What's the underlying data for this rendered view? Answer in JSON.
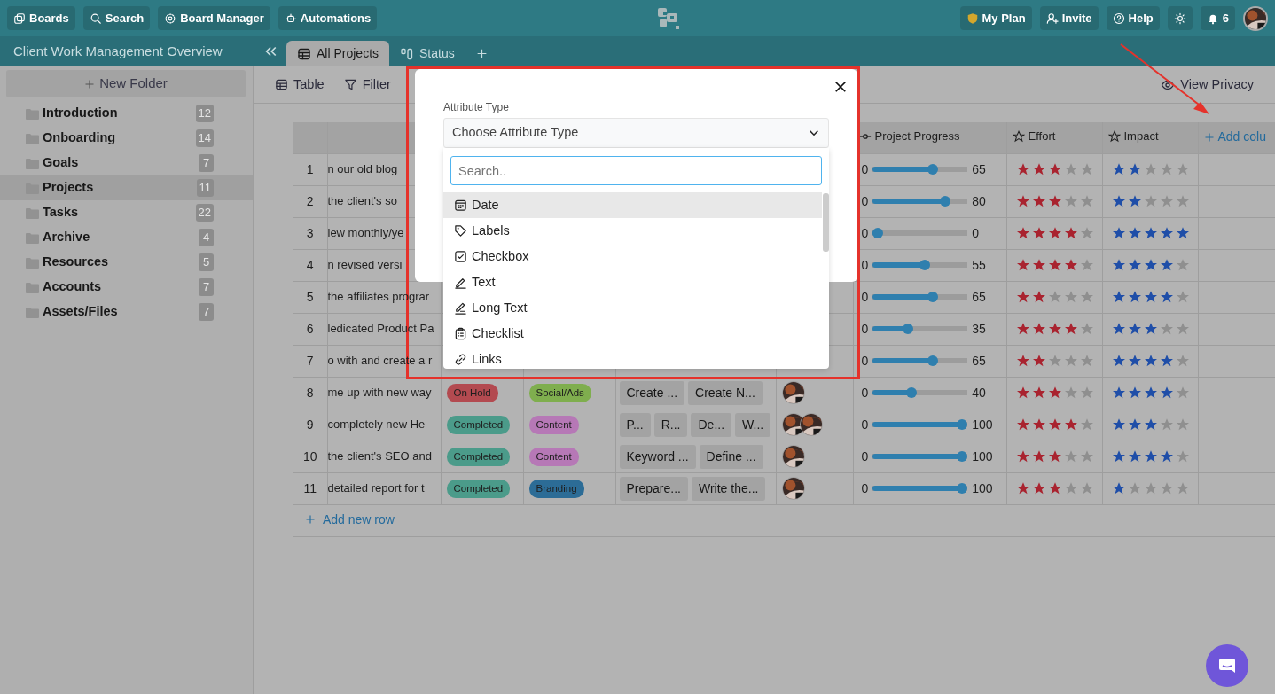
{
  "topbar": {
    "left_buttons": [
      {
        "kind": "boards",
        "label": "Boards"
      },
      {
        "kind": "search",
        "label": "Search"
      },
      {
        "kind": "manager",
        "label": "Board Manager"
      },
      {
        "kind": "automations",
        "label": "Automations"
      }
    ],
    "right_buttons": [
      {
        "kind": "plan",
        "label": "My Plan"
      },
      {
        "kind": "invite",
        "label": "Invite"
      },
      {
        "kind": "help",
        "label": "Help"
      },
      {
        "kind": "theme"
      },
      {
        "kind": "notifications",
        "label": "6"
      }
    ]
  },
  "board_title": "Client Work Management Overview",
  "tabs": [
    {
      "kind": "table",
      "label": "All Projects",
      "selected": true
    },
    {
      "kind": "kanban",
      "label": "Status",
      "selected": false
    }
  ],
  "sidebar": {
    "new_folder": "New Folder",
    "items": [
      {
        "label": "Introduction",
        "count": "12",
        "selected": false
      },
      {
        "label": "Onboarding",
        "count": "14",
        "selected": false
      },
      {
        "label": "Goals",
        "count": "7",
        "selected": false
      },
      {
        "label": "Projects",
        "count": "11",
        "selected": true
      },
      {
        "label": "Tasks",
        "count": "22",
        "selected": false
      },
      {
        "label": "Archive",
        "count": "4",
        "selected": false
      },
      {
        "label": "Resources",
        "count": "5",
        "selected": false
      },
      {
        "label": "Accounts",
        "count": "7",
        "selected": false
      },
      {
        "label": "Assets/Files",
        "count": "7",
        "selected": false
      }
    ]
  },
  "toolbar": {
    "left": [
      {
        "kind": "table",
        "label": "Table"
      },
      {
        "kind": "filter",
        "label": "Filter"
      }
    ],
    "view_privacy": "View Privacy"
  },
  "table": {
    "columns": [
      {
        "kind": "progress",
        "label": "Project Progress"
      },
      {
        "kind": "stars",
        "label": "Effort"
      },
      {
        "kind": "stars",
        "label": "Impact"
      }
    ],
    "add_column": "Add colu",
    "rows": [
      {
        "number": "1",
        "title": "n our old blog",
        "progress": {
          "min": "0",
          "level": 0.65,
          "value": "65"
        },
        "effort": {
          "stars": 3
        },
        "impact": {
          "stars": 2
        }
      },
      {
        "number": "2",
        "title": "the client's so",
        "progress": {
          "min": "0",
          "level": 0.8,
          "value": "80"
        },
        "effort": {
          "stars": 3
        },
        "impact": {
          "stars": 2
        }
      },
      {
        "number": "3",
        "title": "iew monthly/ye",
        "progress": {
          "min": "0",
          "level": 0,
          "value": "0"
        },
        "effort": {
          "stars": 4
        },
        "impact": {
          "stars": 5
        }
      },
      {
        "number": "4",
        "title": "n revised versi",
        "progress": {
          "min": "0",
          "level": 0.55,
          "value": "55"
        },
        "effort": {
          "stars": 4
        },
        "impact": {
          "stars": 4
        }
      },
      {
        "number": "5",
        "title": "the affiliates prograr",
        "progress": {
          "min": "0",
          "level": 0.65,
          "value": "65"
        },
        "effort": {
          "stars": 2
        },
        "impact": {
          "stars": 4
        }
      },
      {
        "number": "6",
        "title": "ledicated Product Pa",
        "progress": {
          "min": "0",
          "level": 0.35,
          "value": "35"
        },
        "effort": {
          "stars": 4
        },
        "impact": {
          "stars": 3
        }
      },
      {
        "number": "7",
        "title": "o with and create a r",
        "progress": {
          "min": "0",
          "level": 0.65,
          "value": "65"
        },
        "effort": {
          "stars": 2
        },
        "impact": {
          "stars": 4
        }
      },
      {
        "number": "8",
        "title": "me up with new way",
        "status": {
          "label": "On Hold",
          "color": "#b34a50"
        },
        "category": {
          "label": "Social/Ads",
          "color": "#7fae4e"
        },
        "tasks": [
          "Create ...",
          "Create N..."
        ],
        "avatars": [
          {
            "kind": "picture"
          }
        ],
        "progress": {
          "min": "0",
          "level": 0.4,
          "value": "40"
        },
        "effort": {
          "stars": 3
        },
        "impact": {
          "stars": 4
        }
      },
      {
        "number": "9",
        "title": "completely new He",
        "status": {
          "label": "Completed",
          "color": "#4b9b8a"
        },
        "category": {
          "label": "Content",
          "color": "#b678b6"
        },
        "tasks": [
          "P...",
          "R...",
          "De...",
          "W..."
        ],
        "avatars": [
          {
            "kind": "picture"
          },
          {
            "kind": "picture"
          }
        ],
        "progress": {
          "min": "0",
          "level": 1,
          "value": "100"
        },
        "effort": {
          "stars": 4
        },
        "impact": {
          "stars": 3
        }
      },
      {
        "number": "10",
        "title": "the client's SEO and",
        "status": {
          "label": "Completed",
          "color": "#4b9b8a"
        },
        "category": {
          "label": "Content",
          "color": "#b678b6"
        },
        "tasks": [
          "Keyword ...",
          "Define ..."
        ],
        "avatars": [
          {
            "kind": "picture"
          }
        ],
        "progress": {
          "min": "0",
          "level": 1,
          "value": "100"
        },
        "effort": {
          "stars": 3
        },
        "impact": {
          "stars": 4
        }
      },
      {
        "number": "11",
        "title": "detailed report for t",
        "status": {
          "label": "Completed",
          "color": "#4b9b8a"
        },
        "category": {
          "label": "Branding",
          "color": "#2c6c96"
        },
        "tasks": [
          "Prepare...",
          "Write the..."
        ],
        "avatars": [
          {
            "kind": "picture"
          }
        ],
        "progress": {
          "min": "0",
          "level": 1,
          "value": "100"
        },
        "effort": {
          "stars": 3
        },
        "impact": {
          "stars": 1
        }
      }
    ],
    "add_row": "Add new row"
  },
  "modal": {
    "field_label": "Attribute Type",
    "select_placeholder": "Choose Attribute Type",
    "search_placeholder": "Search..",
    "options": [
      {
        "kind": "date",
        "label": "Date",
        "selected": true
      },
      {
        "kind": "labels",
        "label": "Labels",
        "selected": false
      },
      {
        "kind": "checkbox",
        "label": "Checkbox",
        "selected": false
      },
      {
        "kind": "text",
        "label": "Text",
        "selected": false
      },
      {
        "kind": "longtext",
        "label": "Long Text",
        "selected": false
      },
      {
        "kind": "checklist",
        "label": "Checklist",
        "selected": false
      },
      {
        "kind": "links",
        "label": "Links",
        "selected": false
      }
    ]
  },
  "annotations": [
    {
      "kind": "frame"
    },
    {
      "kind": "arrow"
    }
  ]
}
